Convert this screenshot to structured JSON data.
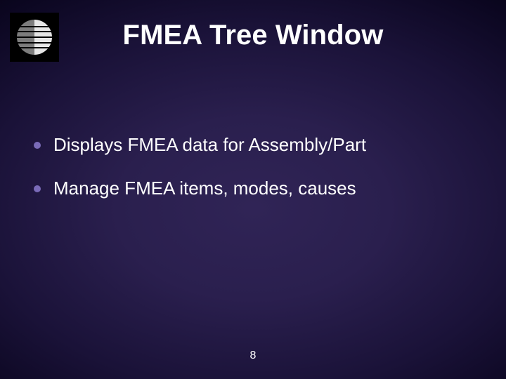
{
  "slide": {
    "title": "FMEA Tree Window",
    "bullets": [
      "Displays FMEA data for Assembly/Part",
      "Manage FMEA items, modes, causes"
    ],
    "page_number": "8"
  }
}
